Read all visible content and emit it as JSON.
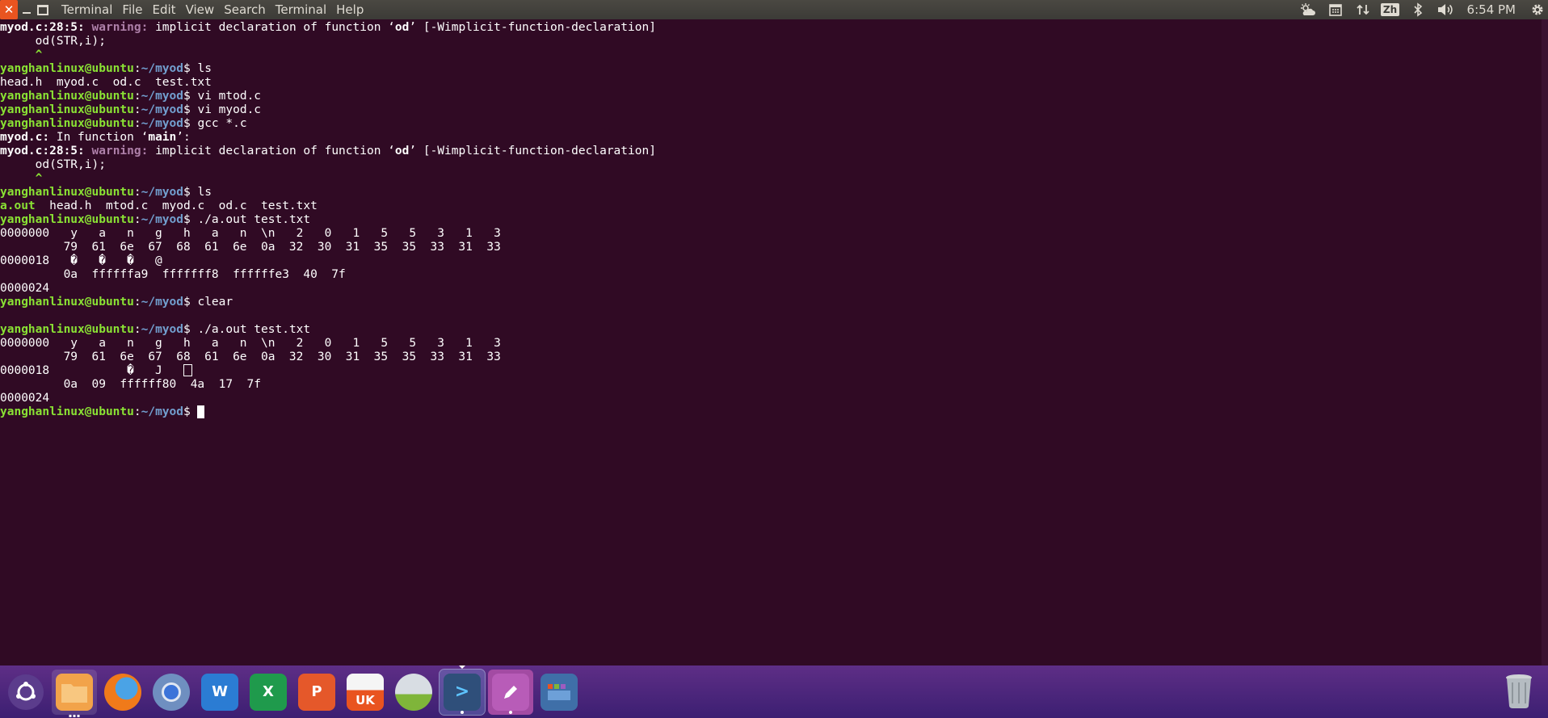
{
  "menubar": {
    "app_title": "Terminal",
    "menus": [
      "File",
      "Edit",
      "View",
      "Search",
      "Terminal",
      "Help"
    ],
    "indicators": {
      "zh_label": "Zh",
      "clock": "6:54 PM"
    }
  },
  "terminal": {
    "prompt_user": "yanghanlinux@ubuntu",
    "prompt_path": "~/myod",
    "lines": [
      {
        "type": "warning",
        "file": "myod.c:28:5:",
        "label": "warning:",
        "msg1": "implicit declaration of function ",
        "q_open": "‘",
        "ident": "od",
        "q_close": "’",
        "flag": "[-Wimplicit-function-declaration]"
      },
      {
        "type": "text",
        "text": "     od(STR,i);"
      },
      {
        "type": "caret",
        "text": "     ^"
      },
      {
        "type": "prompt",
        "cmd": "ls"
      },
      {
        "type": "text",
        "text": "head.h  myod.c  od.c  test.txt"
      },
      {
        "type": "prompt",
        "cmd": "vi mtod.c"
      },
      {
        "type": "prompt",
        "cmd": "vi myod.c"
      },
      {
        "type": "prompt",
        "cmd": "gcc *.c"
      },
      {
        "type": "infunc",
        "file": "myod.c:",
        "msg": " In function ",
        "q_open": "‘",
        "ident": "main",
        "q_close": "’",
        "tail": ":"
      },
      {
        "type": "warning",
        "file": "myod.c:28:5:",
        "label": "warning:",
        "msg1": "implicit declaration of function ",
        "q_open": "‘",
        "ident": "od",
        "q_close": "’",
        "flag": "[-Wimplicit-function-declaration]"
      },
      {
        "type": "text",
        "text": "     od(STR,i);"
      },
      {
        "type": "caret",
        "text": "     ^"
      },
      {
        "type": "prompt",
        "cmd": "ls"
      },
      {
        "type": "lsout",
        "exe": "a.out",
        "rest": "  head.h  mtod.c  myod.c  od.c  test.txt"
      },
      {
        "type": "prompt",
        "cmd": "./a.out test.txt"
      },
      {
        "type": "text",
        "text": "0000000   y   a   n   g   h   a   n  \\n   2   0   1   5   5   3   1   3"
      },
      {
        "type": "text",
        "text": "         79  61  6e  67  68  61  6e  0a  32  30  31  35  35  33  31  33"
      },
      {
        "type": "text",
        "text": "0000018   �   �   �   @"
      },
      {
        "type": "text",
        "text": "         0a  ffffffa9  fffffff8  ffffffe3  40  7f"
      },
      {
        "type": "text",
        "text": "0000024"
      },
      {
        "type": "prompt",
        "cmd": "clear"
      },
      {
        "type": "text",
        "text": ""
      },
      {
        "type": "prompt",
        "cmd": "./a.out test.txt"
      },
      {
        "type": "text",
        "text": "0000000   y   a   n   g   h   a   n  \\n   2   0   1   5   5   3   1   3"
      },
      {
        "type": "text",
        "text": "         79  61  6e  67  68  61  6e  0a  32  30  31  35  35  33  31  33"
      },
      {
        "type": "boxline",
        "text": "0000018           �   J   "
      },
      {
        "type": "text",
        "text": "         0a  09  ffffff80  4a  17  7f"
      },
      {
        "type": "text",
        "text": "0000024"
      },
      {
        "type": "prompt_cursor",
        "cmd": ""
      }
    ]
  },
  "dock": {
    "items": [
      {
        "name": "ubuntu-dash-icon",
        "label": ""
      },
      {
        "name": "files-icon",
        "label": ""
      },
      {
        "name": "firefox-icon",
        "label": ""
      },
      {
        "name": "chromium-icon",
        "label": ""
      },
      {
        "name": "word-icon",
        "label": "W"
      },
      {
        "name": "excel-icon",
        "label": "X"
      },
      {
        "name": "powerpoint-icon",
        "label": "P"
      },
      {
        "name": "ubuntu-software-icon",
        "label": "UK"
      },
      {
        "name": "printer-scanner-icon",
        "label": ""
      },
      {
        "name": "terminal-icon",
        "label": ">"
      },
      {
        "name": "text-editor-icon",
        "label": ""
      },
      {
        "name": "workspace-switcher-icon",
        "label": ""
      }
    ]
  },
  "colors": {
    "terminal_bg": "#300a24",
    "prompt_user": "#8ae234",
    "prompt_path": "#729fcf",
    "warning": "#ad7fa8",
    "accent": "#e95420"
  }
}
